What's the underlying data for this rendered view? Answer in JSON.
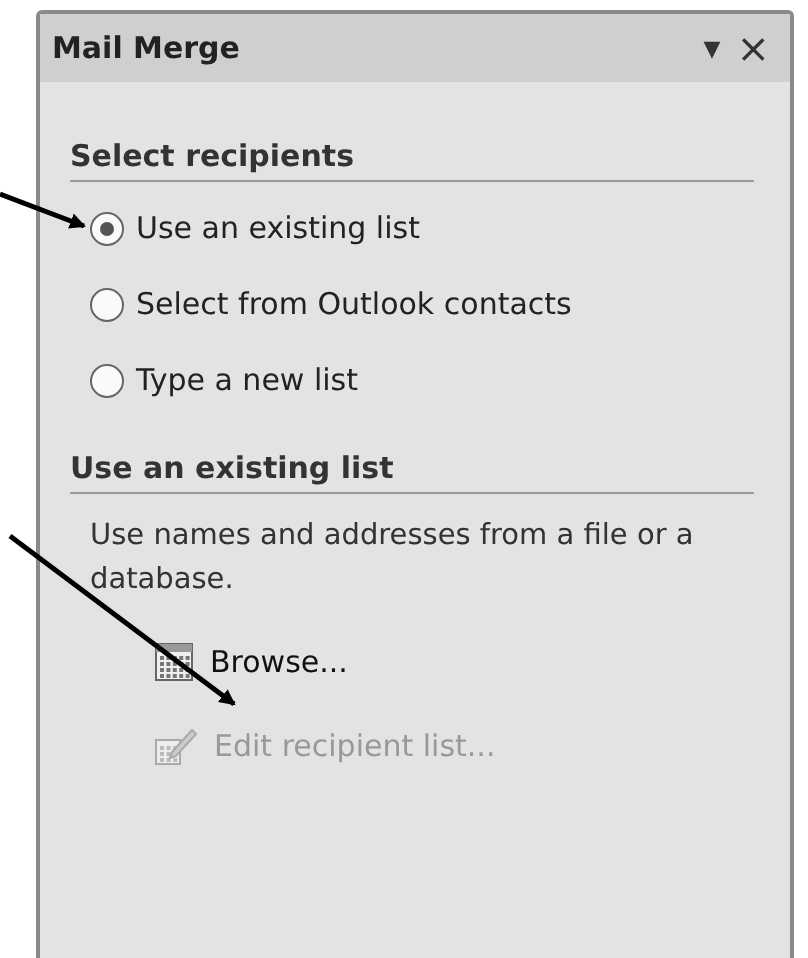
{
  "panel": {
    "title": "Mail Merge",
    "menu_glyph": "▼",
    "close_glyph": "×"
  },
  "select_recipients": {
    "heading": "Select recipients",
    "options": [
      {
        "label": "Use an existing list",
        "selected": true
      },
      {
        "label": "Select from Outlook contacts",
        "selected": false
      },
      {
        "label": "Type a new list",
        "selected": false
      }
    ]
  },
  "existing_list": {
    "heading": "Use an existing list",
    "description": "Use names and addresses from a file or a database.",
    "actions": [
      {
        "kind": "browse",
        "label": "Browse...",
        "disabled": false
      },
      {
        "kind": "edit",
        "label": "Edit recipient list...",
        "disabled": true
      }
    ]
  }
}
